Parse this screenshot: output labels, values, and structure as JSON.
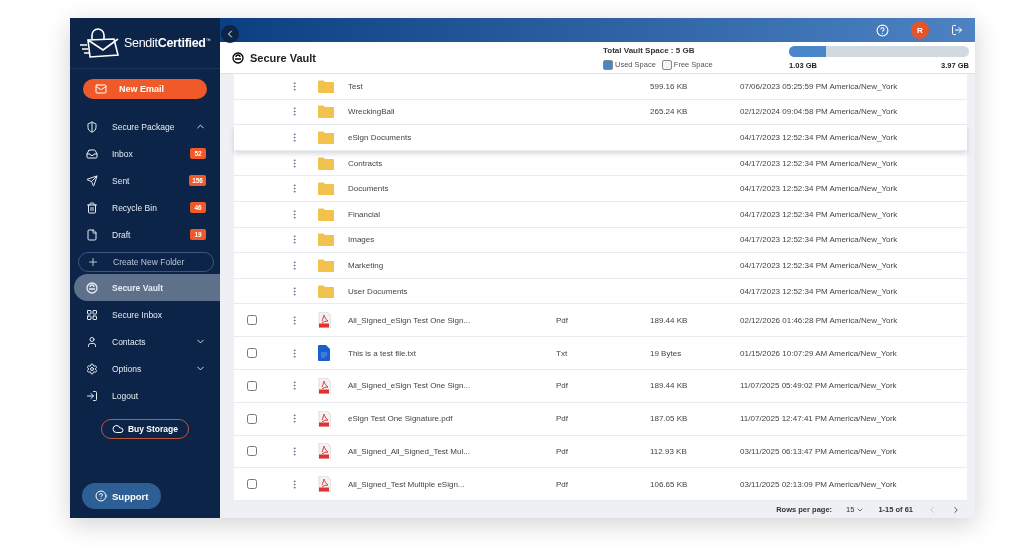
{
  "brand": {
    "prefix": "Sendit",
    "name": "Certified",
    "mark": "™"
  },
  "new_email": "New Email",
  "sidebar": {
    "items": [
      {
        "kind": "section",
        "label": "Secure Package",
        "expanded": true
      },
      {
        "kind": "item",
        "label": "Inbox",
        "badge": "52",
        "selected": false
      },
      {
        "kind": "item",
        "label": "Sent",
        "badge": "156",
        "selected": false
      },
      {
        "kind": "item",
        "label": "Recycle Bin",
        "badge": "46",
        "selected": false
      },
      {
        "kind": "item",
        "label": "Draft",
        "badge": "19",
        "selected": false
      },
      {
        "kind": "action",
        "label": "Create New Folder"
      },
      {
        "kind": "item",
        "label": "Secure Vault",
        "selected": true
      },
      {
        "kind": "item",
        "label": "Secure Inbox",
        "selected": false
      },
      {
        "kind": "section",
        "label": "Contacts",
        "expanded": false
      },
      {
        "kind": "section",
        "label": "Options",
        "expanded": false
      },
      {
        "kind": "item",
        "label": "Logout",
        "selected": false
      }
    ]
  },
  "buy_storage": "Buy Storage",
  "support": "Support",
  "topbar": {
    "avatar": "R"
  },
  "header": {
    "title": "Secure Vault",
    "storage_title": "Total Vault Space : 5 GB",
    "legend": [
      "Used Space",
      "Free Space"
    ],
    "level": 0.206,
    "used": "1.03 GB",
    "free": "3.97 GB"
  },
  "table": {
    "rows": [
      {
        "kind": "folder",
        "name": "Test",
        "size": "599.16 KB",
        "date": "07/06/2023 05:25:59 PM America/New_York",
        "highlighted": false
      },
      {
        "kind": "folder",
        "name": "WreckingBall",
        "size": "265.24 KB",
        "date": "02/12/2024 09:04:58 PM America/New_York",
        "highlighted": false
      },
      {
        "kind": "folder",
        "name": "eSign Documents",
        "date": "04/17/2023 12:52:34 PM America/New_York",
        "highlighted": true
      },
      {
        "kind": "folder",
        "name": "Contracts",
        "date": "04/17/2023 12:52:34 PM America/New_York",
        "highlighted": false
      },
      {
        "kind": "folder",
        "name": "Documents",
        "date": "04/17/2023 12:52:34 PM America/New_York",
        "highlighted": false
      },
      {
        "kind": "folder",
        "name": "Financial",
        "date": "04/17/2023 12:52:34 PM America/New_York",
        "highlighted": false
      },
      {
        "kind": "folder",
        "name": "Images",
        "date": "04/17/2023 12:52:34 PM America/New_York",
        "highlighted": false
      },
      {
        "kind": "folder",
        "name": "Marketing",
        "date": "04/17/2023 12:52:34 PM America/New_York",
        "highlighted": false
      },
      {
        "kind": "folder",
        "name": "User Documents",
        "date": "04/17/2023 12:52:34 PM America/New_York",
        "highlighted": false
      },
      {
        "kind": "pdf",
        "name": "All_Signed_eSign Test One Sign...",
        "type": "Pdf",
        "size": "189.44 KB",
        "date": "02/12/2026 01:46:28 PM America/New_York",
        "checked": false,
        "highlighted": false
      },
      {
        "kind": "txt",
        "name": "This is a test file.txt",
        "type": "Txt",
        "size": "19 Bytes",
        "date": "01/15/2026 10:07:29 AM America/New_York",
        "checked": false,
        "highlighted": false
      },
      {
        "kind": "pdf",
        "name": "All_Signed_eSign Test One Sign...",
        "type": "Pdf",
        "size": "189.44 KB",
        "date": "11/07/2025 05:49:02 PM America/New_York",
        "checked": false,
        "highlighted": false
      },
      {
        "kind": "pdf",
        "name": "eSign Test One Signature.pdf",
        "type": "Pdf",
        "size": "187.05 KB",
        "date": "11/07/2025 12:47:41 PM America/New_York",
        "checked": false,
        "highlighted": false
      },
      {
        "kind": "pdf",
        "name": "All_Signed_All_Signed_Test Mul...",
        "type": "Pdf",
        "size": "112.93 KB",
        "date": "03/11/2025 06:13:47 PM America/New_York",
        "checked": false,
        "highlighted": false
      },
      {
        "kind": "pdf",
        "name": "All_Signed_Test Multiple eSign...",
        "type": "Pdf",
        "size": "106.65 KB",
        "date": "03/11/2025 02:13:09 PM America/New_York",
        "checked": false,
        "highlighted": false
      }
    ]
  },
  "pagination": {
    "label": "Rows per page:",
    "rows": "15",
    "range": "1-15 of 61"
  }
}
